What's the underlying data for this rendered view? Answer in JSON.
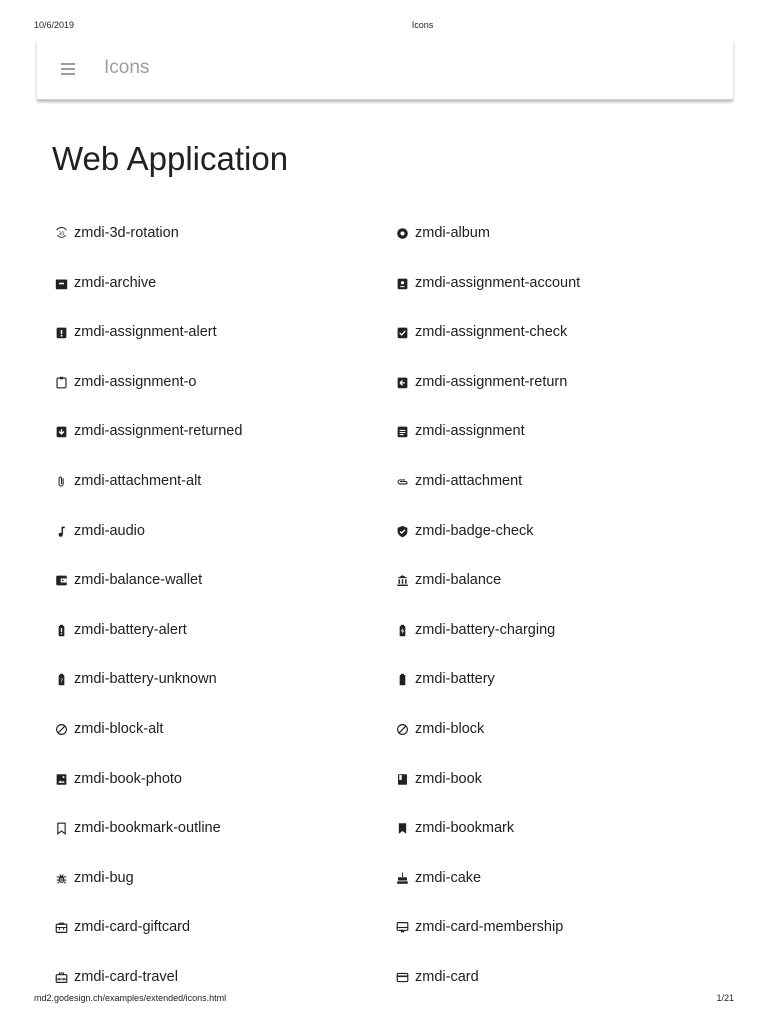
{
  "print_header": {
    "date": "10/6/2019",
    "title": "Icons"
  },
  "print_footer": {
    "url": "md2.godesign.ch/examples/extended/icons.html",
    "page": "1/21"
  },
  "toolbar": {
    "title": "Icons",
    "menu_icon": "menu-icon"
  },
  "section_title": "Web Application",
  "icons_left": [
    {
      "icon": "3d-rotation-icon",
      "label": "zmdi-3d-rotation"
    },
    {
      "icon": "archive-icon",
      "label": "zmdi-archive"
    },
    {
      "icon": "assignment-alert-icon",
      "label": "zmdi-assignment-alert"
    },
    {
      "icon": "assignment-o-icon",
      "label": "zmdi-assignment-o"
    },
    {
      "icon": "assignment-returned-icon",
      "label": "zmdi-assignment-returned"
    },
    {
      "icon": "attachment-alt-icon",
      "label": "zmdi-attachment-alt"
    },
    {
      "icon": "audio-icon",
      "label": "zmdi-audio"
    },
    {
      "icon": "balance-wallet-icon",
      "label": "zmdi-balance-wallet"
    },
    {
      "icon": "battery-alert-icon",
      "label": "zmdi-battery-alert"
    },
    {
      "icon": "battery-unknown-icon",
      "label": "zmdi-battery-unknown"
    },
    {
      "icon": "block-alt-icon",
      "label": "zmdi-block-alt"
    },
    {
      "icon": "book-photo-icon",
      "label": "zmdi-book-photo"
    },
    {
      "icon": "bookmark-outline-icon",
      "label": "zmdi-bookmark-outline"
    },
    {
      "icon": "bug-icon",
      "label": "zmdi-bug"
    },
    {
      "icon": "card-giftcard-icon",
      "label": "zmdi-card-giftcard"
    },
    {
      "icon": "card-travel-icon",
      "label": "zmdi-card-travel"
    }
  ],
  "icons_right": [
    {
      "icon": "album-icon",
      "label": "zmdi-album"
    },
    {
      "icon": "assignment-account-icon",
      "label": "zmdi-assignment-account"
    },
    {
      "icon": "assignment-check-icon",
      "label": "zmdi-assignment-check"
    },
    {
      "icon": "assignment-return-icon",
      "label": "zmdi-assignment-return"
    },
    {
      "icon": "assignment-icon",
      "label": "zmdi-assignment"
    },
    {
      "icon": "attachment-icon",
      "label": "zmdi-attachment"
    },
    {
      "icon": "badge-check-icon",
      "label": "zmdi-badge-check"
    },
    {
      "icon": "balance-icon",
      "label": "zmdi-balance"
    },
    {
      "icon": "battery-charging-icon",
      "label": "zmdi-battery-charging"
    },
    {
      "icon": "battery-icon",
      "label": "zmdi-battery"
    },
    {
      "icon": "block-icon",
      "label": "zmdi-block"
    },
    {
      "icon": "book-icon",
      "label": "zmdi-book"
    },
    {
      "icon": "bookmark-icon",
      "label": "zmdi-bookmark"
    },
    {
      "icon": "cake-icon",
      "label": "zmdi-cake"
    },
    {
      "icon": "card-membership-icon",
      "label": "zmdi-card-membership"
    },
    {
      "icon": "card-icon",
      "label": "zmdi-card"
    }
  ],
  "colors": {
    "text": "#212121",
    "toolbar_muted": "#9e9e9e",
    "background": "#ffffff"
  }
}
